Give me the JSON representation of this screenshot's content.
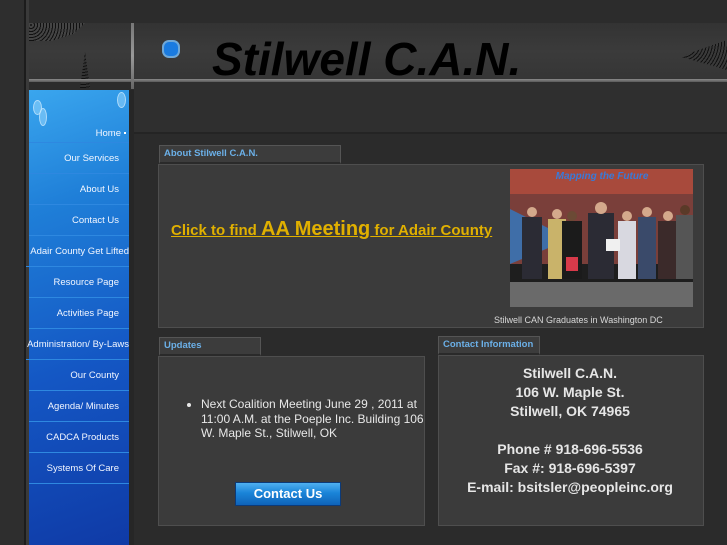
{
  "site": {
    "title": "Stilwell C.A.N."
  },
  "sidebar": {
    "items": [
      {
        "label": "Home",
        "active": true
      },
      {
        "label": "Our Services"
      },
      {
        "label": "About Us"
      },
      {
        "label": "Contact Us"
      },
      {
        "label": "Adair County Get Lifted"
      },
      {
        "label": "Resource Page"
      },
      {
        "label": "Activities Page"
      },
      {
        "label": "Administration/ By-Laws"
      },
      {
        "label": "Our County"
      },
      {
        "label": "Agenda/ Minutes"
      },
      {
        "label": "CADCA Products"
      },
      {
        "label": "Systems Of Care"
      }
    ]
  },
  "about": {
    "tab_label": "About Stilwell C.A.N.",
    "link_prefix": "Click to find ",
    "link_emphasis": "AA Meeting",
    "link_suffix": " for Adair County",
    "photo_banner_text": "Mapping the Future",
    "photo_caption": "Stilwell CAN Graduates in Washington DC"
  },
  "updates": {
    "tab_label": "Updates",
    "items": [
      "Next Coalition Meeting June 29 , 2011 at 11:00 A.M.  at the Poeple Inc. Building 106 W. Maple St., Stilwell, OK"
    ],
    "contact_button": "Contact Us"
  },
  "contact": {
    "tab_label": "Contact Information",
    "name": "Stilwell C.A.N.",
    "street": "106 W. Maple St.",
    "city": "Stilwell, OK 74965",
    "phone": "Phone # 918-696-5536",
    "fax": "Fax #: 918-696-5397",
    "email": "E-mail: bsitsler@peopleinc.org"
  },
  "colors": {
    "accent_blue": "#1a7be0",
    "tab_text": "#6bb0e8",
    "link_gold": "#e0b000"
  }
}
